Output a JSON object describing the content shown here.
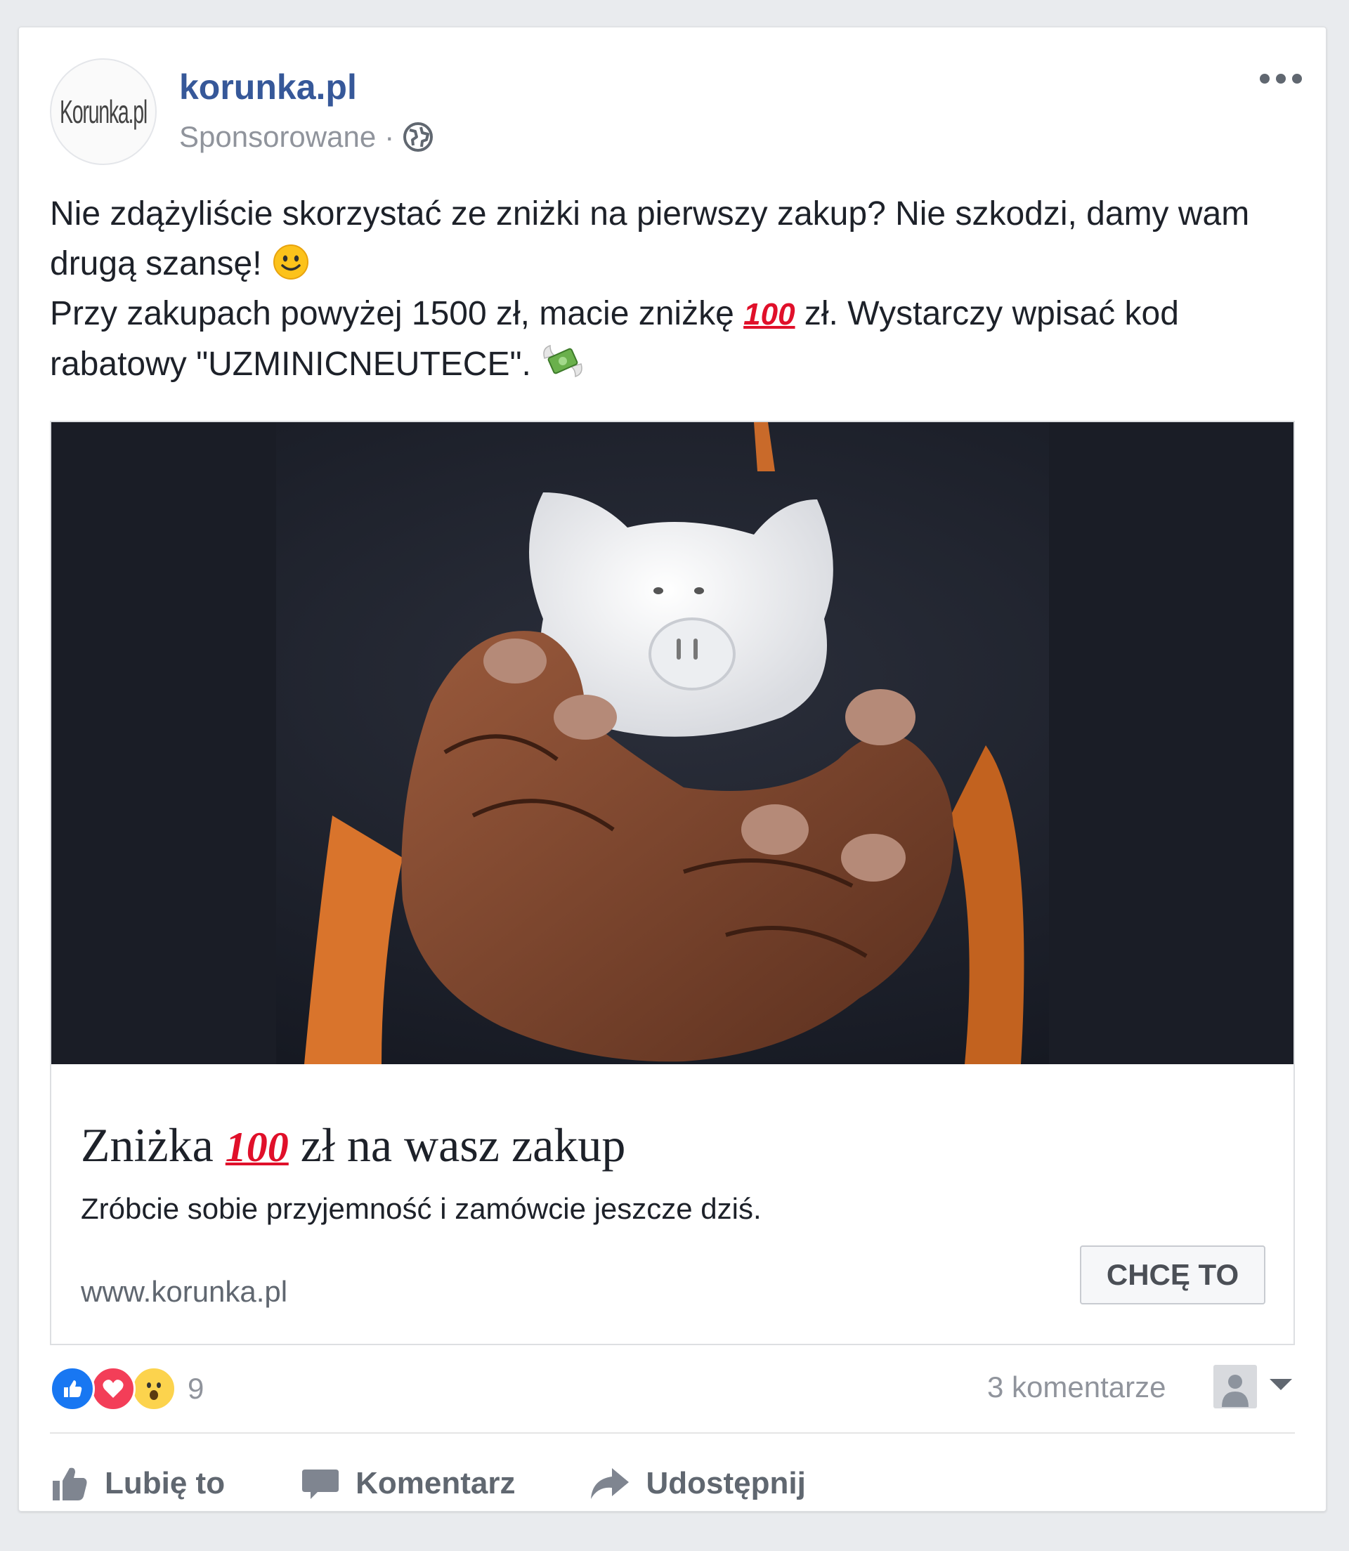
{
  "post": {
    "page_name": "korunka.pl",
    "avatar_text": "Korunka.pl",
    "sponsored_label": "Sponsorowane",
    "separator": "·",
    "text_line1_a": "Nie zdążyliście skorzystać ze zniżki na pierwszy zakup? Nie szkodzi, damy wam drugą szansę! ",
    "text_line2_a": "Przy zakupach powyżej 1500 zł, macie zniżkę ",
    "hundred_emoji": "100",
    "text_line2_b": " zł. Wystarczy wpisać kod rabatowy \"UZMINICNEUTECE\". ",
    "icons": [
      "globe-icon",
      "more-options-icon",
      "smiley-emoji",
      "hundred-points-emoji",
      "money-with-wings-emoji"
    ]
  },
  "link_card": {
    "title_a": "Zniżka ",
    "title_hundred": "100",
    "title_b": " zł na wasz zakup",
    "description": "Zróbcie sobie przyjemność i zamówcie jeszcze dziś.",
    "domain": "www.korunka.pl",
    "cta_label": "CHCĘ TO"
  },
  "footer": {
    "reaction_count": "9",
    "reactions": [
      "like",
      "love",
      "wow"
    ],
    "comments_count": "3 komentarze",
    "like_label": "Lubię to",
    "comment_label": "Komentarz",
    "share_label": "Udostępnij"
  },
  "colors": {
    "page_name": "#365899",
    "muted_text": "#90949c",
    "like_blue": "#1877f2",
    "love_red": "#f33e58",
    "hundred_red": "#e0102a"
  }
}
